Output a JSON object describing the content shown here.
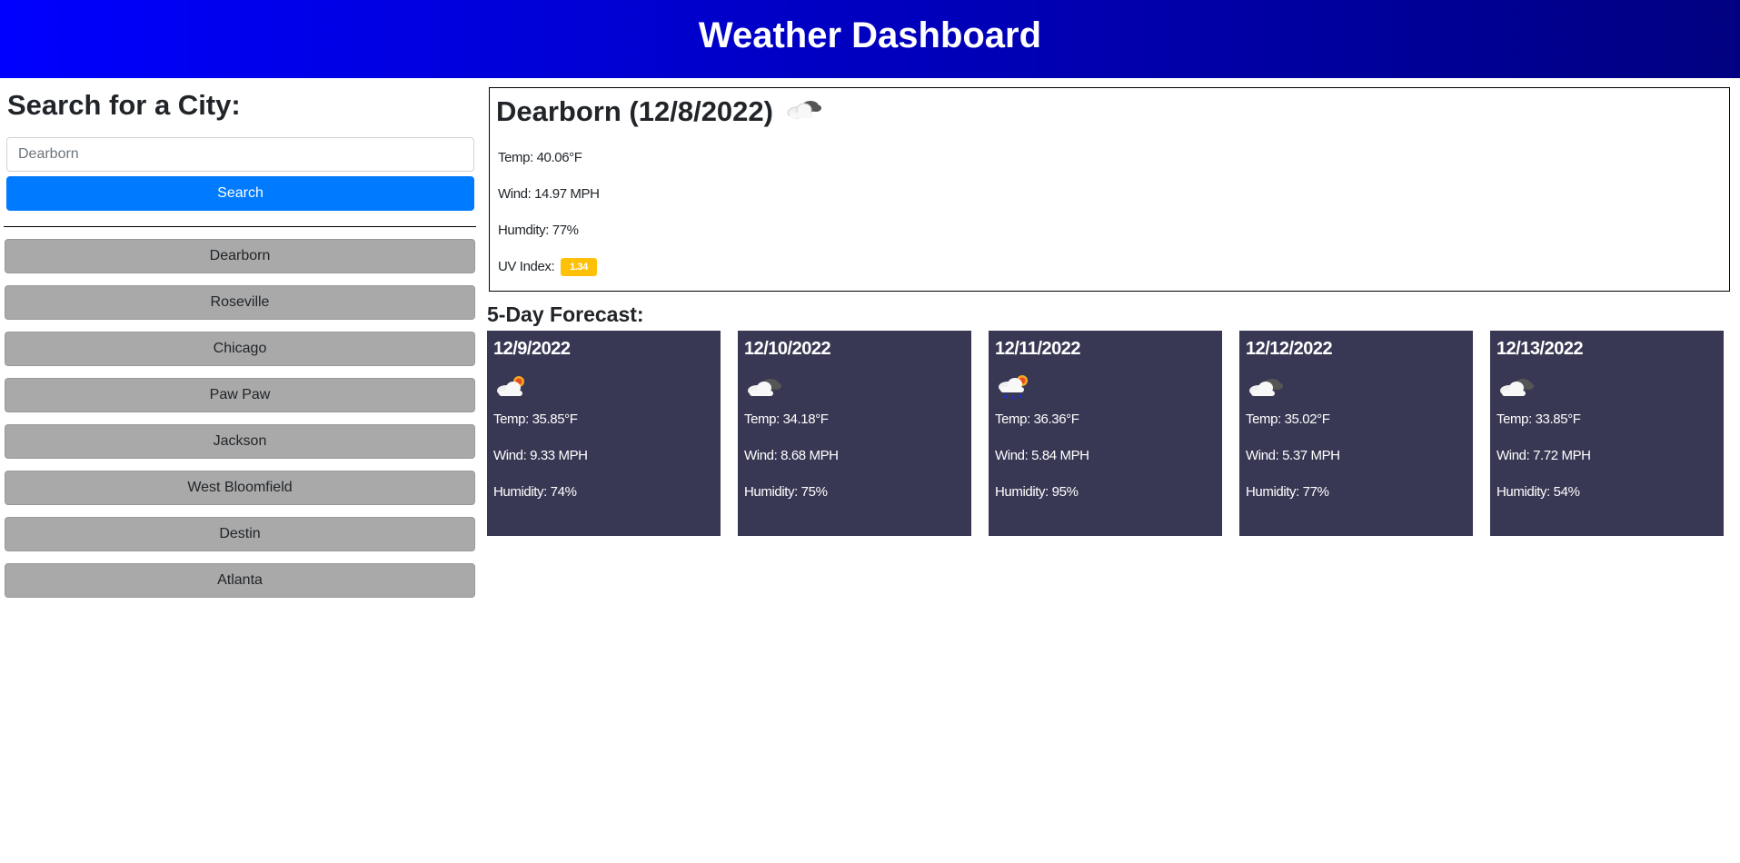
{
  "header": {
    "title": "Weather Dashboard"
  },
  "sidebar": {
    "search_title": "Search for a City:",
    "search_placeholder": "Dearborn",
    "search_button": "Search",
    "history": [
      "Dearborn",
      "Roseville",
      "Chicago",
      "Paw Paw",
      "Jackson",
      "West Bloomfield",
      "Destin",
      "Atlanta"
    ]
  },
  "current": {
    "title": "Dearborn (12/8/2022)",
    "icon": "cloud-icon",
    "temp": "Temp: 40.06°F",
    "wind": "Wind: 14.97 MPH",
    "humidity": "Humdity: 77%",
    "uv_label": "UV Index:",
    "uv_value": "1.34",
    "uv_color": "#ffc107"
  },
  "forecast": {
    "title": "5-Day Forecast:",
    "days": [
      {
        "date": "12/9/2022",
        "icon": "cloud-sun-icon",
        "temp": "Temp: 35.85°F",
        "wind": "Wind: 9.33 MPH",
        "humidity": "Humidity: 74%"
      },
      {
        "date": "12/10/2022",
        "icon": "cloud-icon",
        "temp": "Temp: 34.18°F",
        "wind": "Wind: 8.68 MPH",
        "humidity": "Humidity: 75%"
      },
      {
        "date": "12/11/2022",
        "icon": "rain-sun-icon",
        "temp": "Temp: 36.36°F",
        "wind": "Wind: 5.84 MPH",
        "humidity": "Humidity: 95%"
      },
      {
        "date": "12/12/2022",
        "icon": "cloud-icon",
        "temp": "Temp: 35.02°F",
        "wind": "Wind: 5.37 MPH",
        "humidity": "Humidity: 77%"
      },
      {
        "date": "12/13/2022",
        "icon": "cloud-icon",
        "temp": "Temp: 33.85°F",
        "wind": "Wind: 7.72 MPH",
        "humidity": "Humidity: 54%"
      }
    ]
  },
  "colors": {
    "header_gradient_start": "#0000ff",
    "header_gradient_end": "#000080",
    "search_button": "#007bff",
    "history_button": "#a9a9a9",
    "forecast_card": "#383854"
  }
}
